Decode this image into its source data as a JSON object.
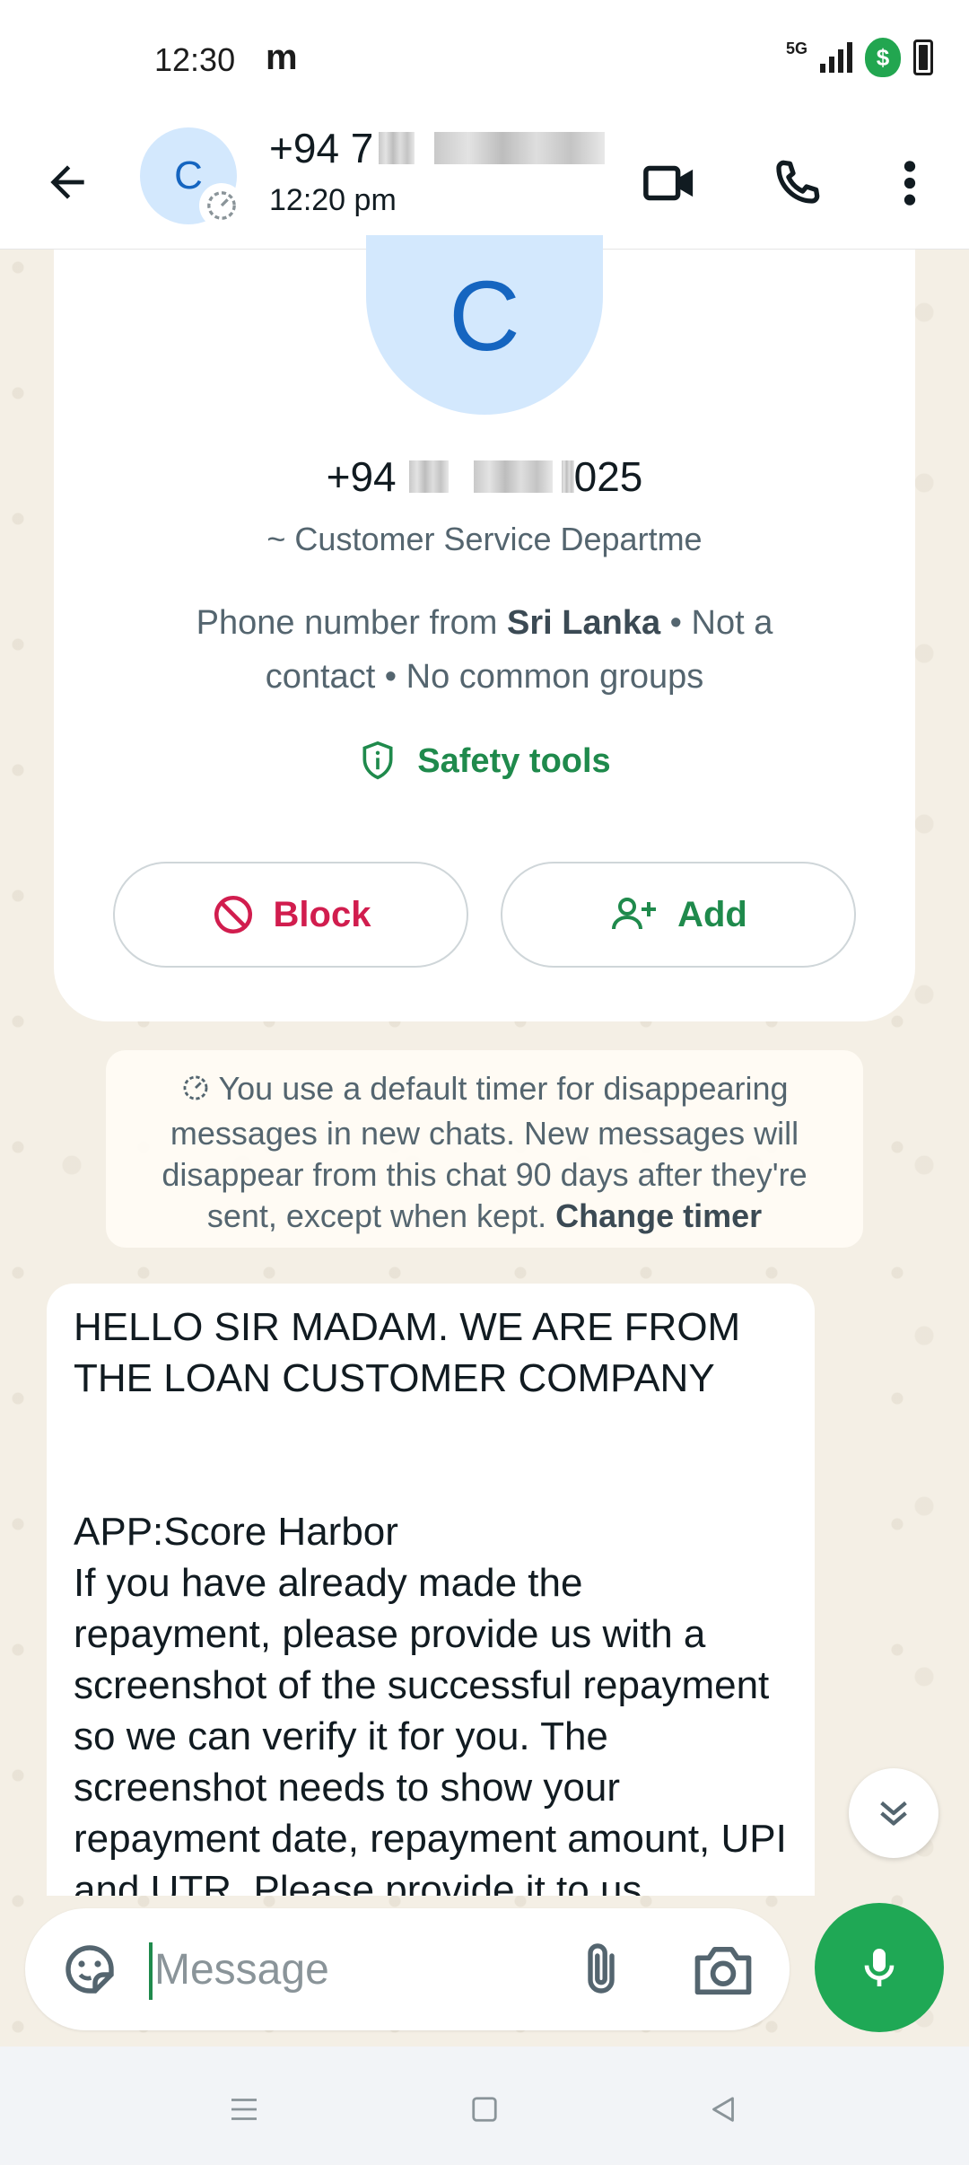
{
  "status_bar": {
    "time": "12:30",
    "carrier_glyph": "m",
    "network": "5G",
    "icons": [
      "signal-icon",
      "security-shield-icon",
      "battery-icon"
    ],
    "shield_symbol": "$"
  },
  "header": {
    "contact_name_prefix": "+94 7",
    "last_seen": "12:20 pm",
    "avatar_letter": "C",
    "icons": [
      "back-arrow-icon",
      "video-call-icon",
      "voice-call-icon",
      "more-options-icon"
    ]
  },
  "info_card": {
    "avatar_letter": "C",
    "phone_prefix": "+94",
    "phone_suffix": "025",
    "alias": "~ Customer Service Departme",
    "meta_prefix": "Phone number from ",
    "meta_country": "Sri Lanka",
    "meta_suffix": " • Not a contact • No common groups",
    "safety_tools": "Safety tools",
    "block_label": "Block",
    "add_label": "Add"
  },
  "notice": {
    "text": "You use a default timer for disappearing messages in new chats. New messages will disappear from this chat 90 days after they're sent, except when kept. ",
    "link": "Change timer"
  },
  "message": {
    "text": "HELLO SIR MADAM. WE ARE FROM THE LOAN CUSTOMER COMPANY\n\n\nAPP:Score Harbor\nIf you have already made the repayment, please provide us with a screenshot of the successful repayment so we can verify it for you. The screenshot needs to show your repayment date, repayment amount, UPI and UTR. Please provide it to us"
  },
  "composer": {
    "placeholder": "Message"
  },
  "colors": {
    "accent_green": "#1fa855",
    "block_red": "#d11d4e",
    "avatar_bg": "#d3e8fd",
    "avatar_fg": "#1565c0"
  }
}
